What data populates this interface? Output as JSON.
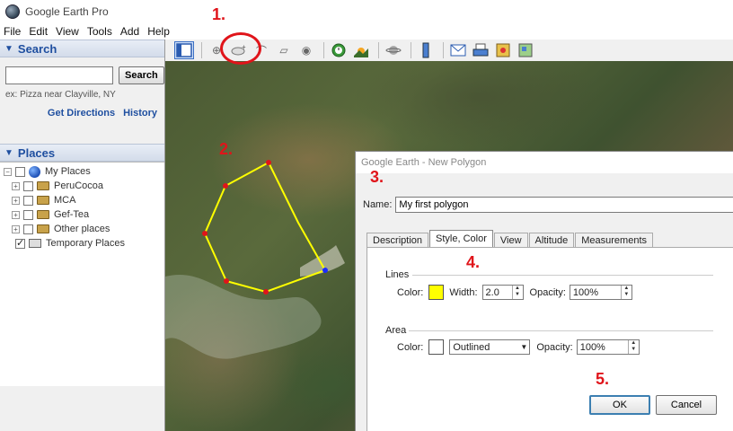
{
  "window": {
    "title": "Google Earth Pro"
  },
  "menu": [
    "File",
    "Edit",
    "View",
    "Tools",
    "Add",
    "Help"
  ],
  "search": {
    "header": "Search",
    "button": "Search",
    "input_value": "",
    "example": "ex: Pizza near Clayville, NY",
    "links": [
      "Get Directions",
      "History"
    ]
  },
  "places": {
    "header": "Places",
    "items": [
      {
        "label": "My Places",
        "checked": false
      },
      {
        "label": "PeruCocoa",
        "checked": false
      },
      {
        "label": "MCA",
        "checked": false
      },
      {
        "label": "Gef-Tea",
        "checked": false
      },
      {
        "label": "Other places",
        "checked": false
      },
      {
        "label": "Temporary Places",
        "checked": true
      }
    ]
  },
  "toolbar": {
    "buttons": [
      "sidebar-toggle",
      "add-placemark",
      "add-polygon",
      "add-path",
      "add-overlay",
      "record-tour",
      "historical-imagery",
      "sunlight",
      "planets",
      "ruler",
      "email",
      "print",
      "save-image",
      "view-in-maps"
    ]
  },
  "annotations": {
    "step1": "1.",
    "step2": "2.",
    "step3": "3.",
    "step4": "4.",
    "step5": "5."
  },
  "dialog": {
    "title": "Google Earth - New Polygon",
    "name_label": "Name:",
    "name_value": "My first polygon",
    "tabs": [
      "Description",
      "Style, Color",
      "View",
      "Altitude",
      "Measurements"
    ],
    "active_tab": "Style, Color",
    "lines": {
      "label": "Lines",
      "color_label": "Color:",
      "color": "#ffff00",
      "width_label": "Width:",
      "width_value": "2.0",
      "opacity_label": "Opacity:",
      "opacity_value": "100%"
    },
    "area": {
      "label": "Area",
      "color_label": "Color:",
      "color": "#ffffff",
      "fill_mode": "Outlined",
      "opacity_label": "Opacity:",
      "opacity_value": "100%"
    },
    "ok": "OK",
    "cancel": "Cancel"
  },
  "colors": {
    "annotation": "#e0141a",
    "polygon_line": "#ffff00",
    "vertex": "#e0141a",
    "active_vertex": "#1a2cff",
    "link": "#1f4fa0"
  }
}
